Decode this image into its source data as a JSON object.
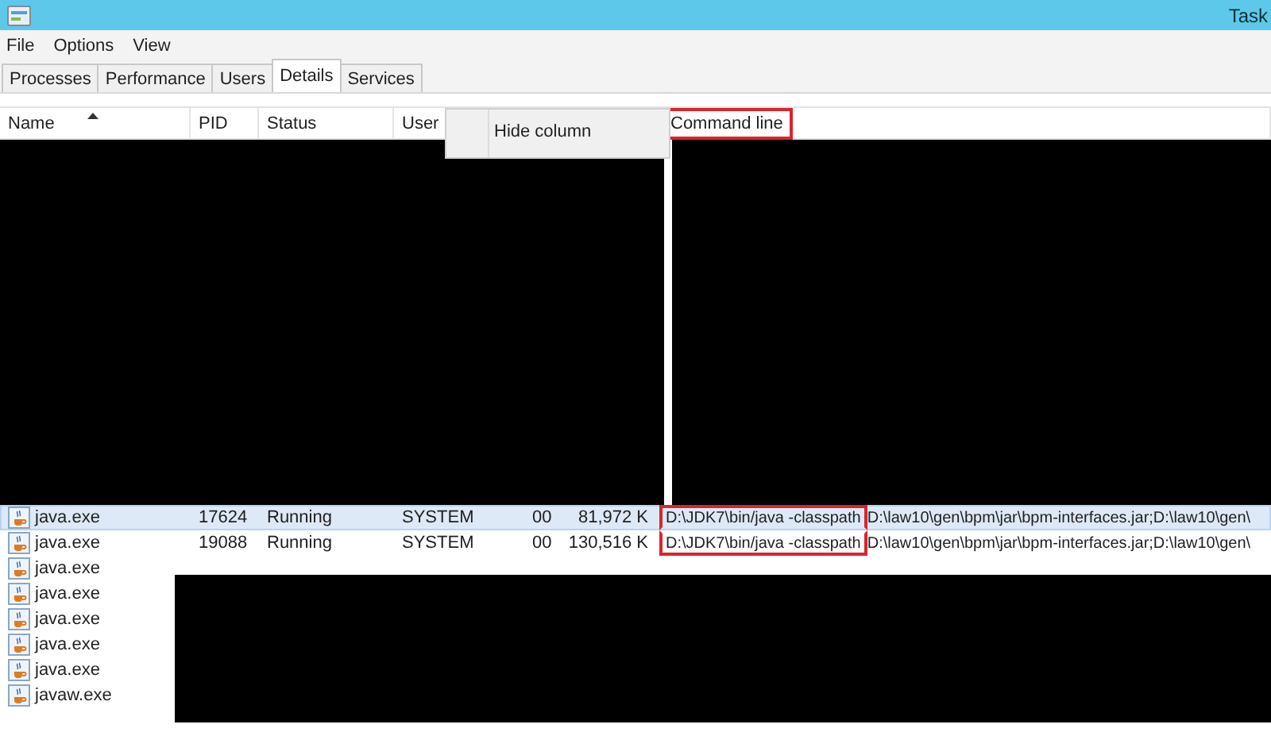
{
  "window": {
    "title": "Task"
  },
  "menu": [
    "File",
    "Options",
    "View"
  ],
  "tabs": [
    {
      "label": "Processes",
      "selected": false
    },
    {
      "label": "Performance",
      "selected": false
    },
    {
      "label": "Users",
      "selected": false
    },
    {
      "label": "Details",
      "selected": true
    },
    {
      "label": "Services",
      "selected": false
    }
  ],
  "table": {
    "columns": [
      {
        "label": "Name",
        "sorted": true
      },
      {
        "label": "PID"
      },
      {
        "label": "Status"
      },
      {
        "label": "User"
      },
      {
        "label": "Command line",
        "highlighted": true
      }
    ],
    "rows": [
      {
        "name": "java.exe",
        "pid": "17624",
        "status": "Running",
        "user": "SYSTEM",
        "cpu": "00",
        "memory": "81,972 K",
        "command": "D:\\JDK7\\bin/java -classpath",
        "command_rest": "D:\\law10\\gen\\bpm\\jar\\bpm-interfaces.jar;D:\\law10\\gen\\",
        "selected": true,
        "highlighted": true
      },
      {
        "name": "java.exe",
        "pid": "19088",
        "status": "Running",
        "user": "SYSTEM",
        "cpu": "00",
        "memory": "130,516 K",
        "command": "D:\\JDK7\\bin/java -classpath",
        "command_rest": "D:\\law10\\gen\\bpm\\jar\\bpm-interfaces.jar;D:\\law10\\gen\\",
        "selected": false,
        "highlighted": true
      },
      {
        "name": "java.exe",
        "selected": false
      },
      {
        "name": "java.exe",
        "selected": false
      },
      {
        "name": "java.exe",
        "selected": false
      },
      {
        "name": "java.exe",
        "selected": false
      },
      {
        "name": "java.exe",
        "selected": false
      },
      {
        "name": "javaw.exe",
        "selected": false
      }
    ]
  },
  "context_menu": {
    "items": [
      "Hide column"
    ]
  }
}
